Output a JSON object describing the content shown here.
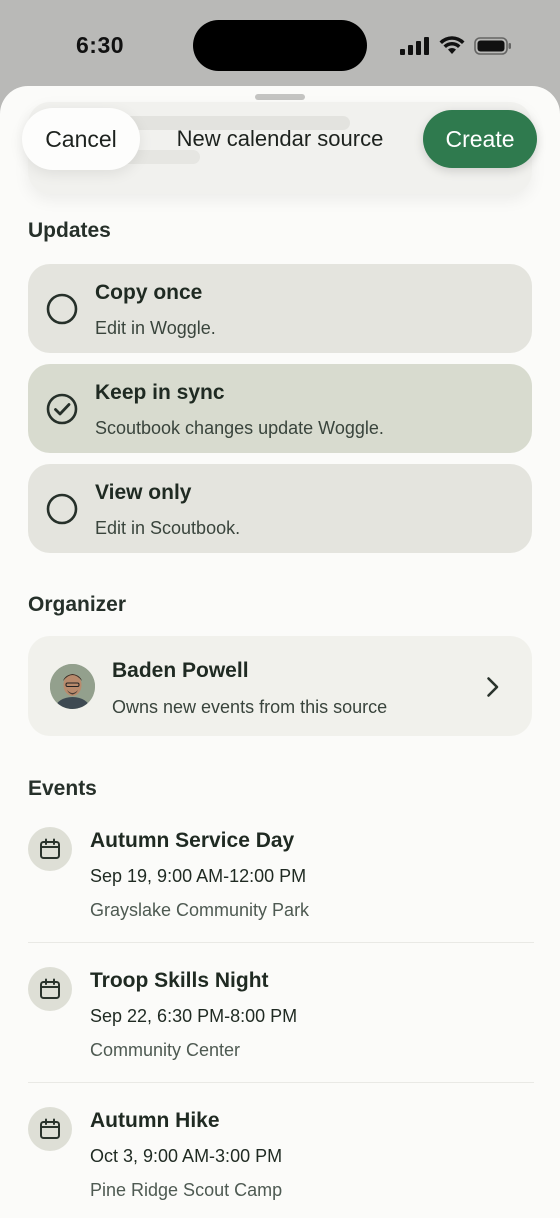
{
  "status": {
    "time": "6:30"
  },
  "header": {
    "cancel_label": "Cancel",
    "title": "New calendar source",
    "create_label": "Create"
  },
  "updates": {
    "label": "Updates",
    "options": [
      {
        "title": "Copy once",
        "subtitle": "Edit in Woggle.",
        "selected": false
      },
      {
        "title": "Keep in sync",
        "subtitle": "Scoutbook changes update Woggle.",
        "selected": true
      },
      {
        "title": "View only",
        "subtitle": "Edit in Scoutbook.",
        "selected": false
      }
    ]
  },
  "organizer": {
    "label": "Organizer",
    "name": "Baden Powell",
    "subtitle": "Owns new events from this source"
  },
  "events": {
    "label": "Events",
    "items": [
      {
        "title": "Autumn Service Day",
        "time": "Sep 19, 9:00 AM-12:00 PM",
        "place": "Grayslake Community Park"
      },
      {
        "title": "Troop Skills Night",
        "time": "Sep 22, 6:30 PM-8:00 PM",
        "place": "Community Center"
      },
      {
        "title": "Autumn Hike",
        "time": "Oct 3, 9:00 AM-3:00 PM",
        "place": "Pine Ridge Scout Camp"
      }
    ]
  },
  "colors": {
    "accent": "#2f7a4e",
    "option_bg": "#e4e4de",
    "option_selected_bg": "#d8dbcf"
  }
}
